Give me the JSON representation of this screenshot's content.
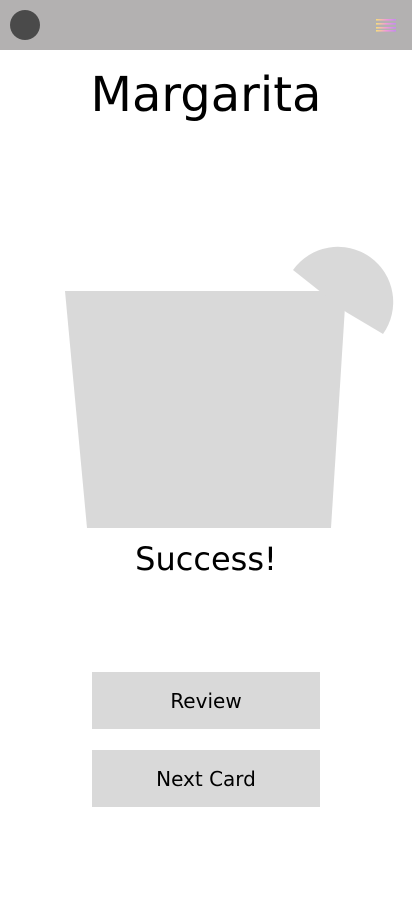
{
  "header": {
    "avatar_icon": "avatar-icon",
    "menu_icon": "hamburger-menu-icon",
    "bg_color": "#b3b1b1",
    "avatar_color": "#4a4a4a"
  },
  "card": {
    "title": "Margarita",
    "illustration": "cocktail-glass-with-lime-icon",
    "result_text": "Success!"
  },
  "actions": {
    "review_label": "Review",
    "next_label": "Next Card"
  },
  "colors": {
    "placeholder_gray": "#d9d9d9",
    "background": "#ffffff",
    "text": "#000000"
  }
}
